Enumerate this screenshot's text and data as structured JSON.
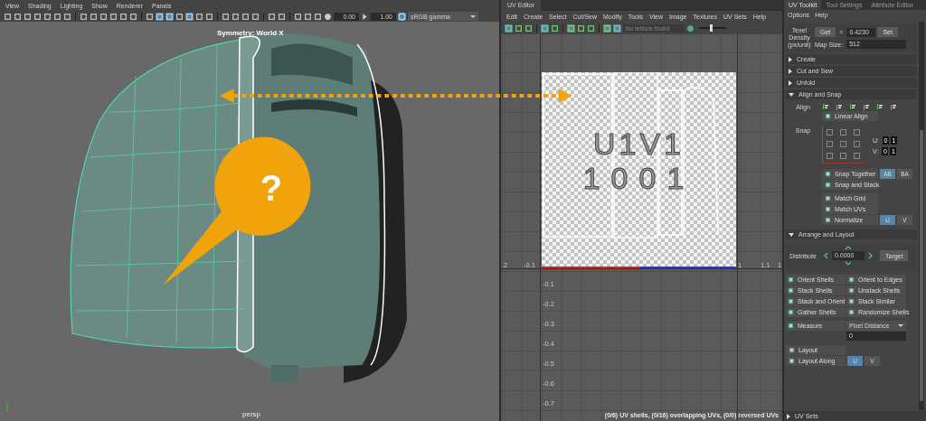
{
  "viewport": {
    "menu": [
      "View",
      "Shading",
      "Lighting",
      "Show",
      "Renderer",
      "Panels"
    ],
    "toolbar_icons": [
      {
        "selected": false
      },
      {
        "selected": false
      },
      {
        "selected": false
      },
      {
        "selected": false
      },
      {
        "selected": false
      },
      {
        "selected": false
      },
      {
        "selected": false
      },
      {
        "selected": false
      },
      {
        "selected": false
      },
      {
        "selected": false
      },
      {
        "selected": false
      },
      {
        "selected": false
      },
      {
        "selected": false
      },
      {
        "selected": false
      },
      {
        "selected": true
      },
      {
        "selected": true
      },
      {
        "selected": false
      },
      {
        "selected": true
      },
      {
        "selected": false
      },
      {
        "selected": false
      },
      {
        "selected": false
      },
      {
        "selected": false
      },
      {
        "selected": false
      },
      {
        "selected": false
      },
      {
        "selected": false
      },
      {
        "selected": false
      },
      {
        "selected": false
      },
      {
        "selected": false
      },
      {
        "selected": false
      }
    ],
    "exposure": "0.00",
    "gamma": "1.00",
    "color_space": "sRGB gamma",
    "symmetry_label": "Symmetry: World X",
    "camera_label": "persp",
    "callout": "?"
  },
  "uv_editor": {
    "title": "UV Editor",
    "menu": [
      "Edit",
      "Create",
      "Select",
      "Cut/Sew",
      "Modify",
      "Tools",
      "View",
      "Image",
      "Textures",
      "UV Sets",
      "Help"
    ],
    "toolbar_icons": [
      {
        "selected": true
      },
      {
        "selected": false
      },
      {
        "selected": false
      },
      {
        "selected": true
      },
      {
        "selected": false
      },
      {
        "selected": true
      },
      {
        "selected": false
      },
      {
        "selected": false
      },
      {
        "selected": true
      },
      {
        "selected": true
      }
    ],
    "texture_field": {
      "placeholder": "No texture found"
    },
    "brightness": {
      "level": 0.45
    },
    "tile_labels": [
      "U1V1",
      "1001"
    ],
    "u_ticks": [
      ".2",
      "-0.1",
      "1",
      "1.1",
      "1"
    ],
    "v_ticks": [
      "-0.1",
      "-0.2",
      "-0.3",
      "-0.4",
      "-0.5",
      "-0.6",
      "-0.7"
    ],
    "status": "(0/6) UV shells, (0/16) overlapping UVs, (0/0) reversed UVs"
  },
  "toolkit": {
    "tabs": [
      {
        "label": "UV Toolkit",
        "selected": true
      },
      {
        "label": "Tool Settings",
        "selected": false
      },
      {
        "label": "Attribute Editor",
        "selected": false
      }
    ],
    "menu": [
      "Options",
      "Help"
    ],
    "texel_density": {
      "label": "Texel Density (px/unit)",
      "get": "Get",
      "equals": "=",
      "value": "0.4230",
      "set": "Set",
      "map_size_label": "Map Size:",
      "map_size": "512"
    },
    "sections": [
      {
        "title": "Create",
        "expanded": false
      },
      {
        "title": "Cut and Sew",
        "expanded": false
      },
      {
        "title": "Unfold",
        "expanded": false
      },
      {
        "title": "Align and Snap",
        "expanded": true
      }
    ],
    "align": {
      "label": "Align",
      "linear_align": "Linear Align"
    },
    "snap": {
      "label": "Snap",
      "anchors": [
        {
          "checked": false
        },
        {
          "checked": false
        },
        {
          "checked": false
        },
        {
          "checked": false
        },
        {
          "checked": false
        },
        {
          "checked": false
        },
        {
          "checked": false
        },
        {
          "checked": false
        },
        {
          "checked": false
        }
      ],
      "u_label": "U:",
      "u_values": [
        "0",
        "1"
      ],
      "v_label": "V:",
      "v_values": [
        "0",
        "1"
      ]
    },
    "snap_buttons": [
      {
        "label": "Snap Together",
        "options": [
          {
            "label": "AB",
            "selected": true
          },
          {
            "label": "BA",
            "selected": false
          }
        ]
      },
      {
        "label": "Snap and Stack"
      },
      {
        "label": "Match Grid"
      },
      {
        "label": "Match UVs"
      },
      {
        "label": "Normalize",
        "options": [
          {
            "label": "U",
            "selected": true
          },
          {
            "label": "V",
            "selected": false
          }
        ]
      }
    ],
    "arrange_section": {
      "title": "Arrange and Layout",
      "expanded": true
    },
    "distribute": {
      "label": "Distribute",
      "value": "0.0000",
      "target": "Target"
    },
    "arrange_buttons": [
      "Orient Shells",
      "Orient to Edges",
      "Stack Shells",
      "Unstack Shells",
      "Stack and Orient",
      "Stack Similar",
      "Gather Shells",
      "Randomize Shells"
    ],
    "measure": {
      "label": "Measure",
      "mode": "Pixel Distance",
      "value": "0"
    },
    "layout_buttons": [
      {
        "label": "Layout"
      },
      {
        "label": "Layout Along",
        "options": [
          {
            "label": "U",
            "selected": true
          },
          {
            "label": "V",
            "selected": false
          }
        ]
      }
    ],
    "uv_sets": {
      "title": "UV Sets",
      "expanded": false
    }
  }
}
